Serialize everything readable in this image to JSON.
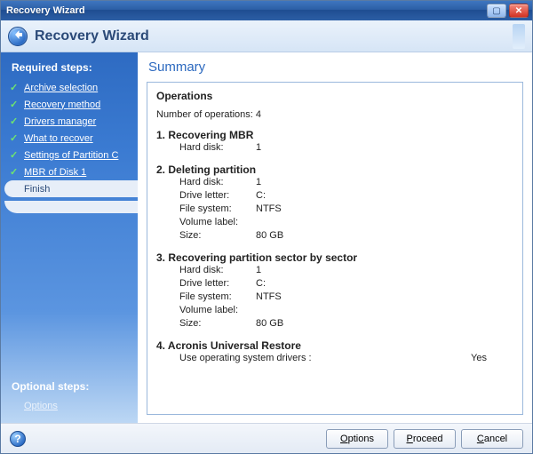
{
  "window": {
    "title": "Recovery Wizard",
    "maximize_icon": "maximize-icon",
    "close_icon": "close-icon"
  },
  "header": {
    "title": "Recovery Wizard",
    "back_icon": "back-arrow-icon"
  },
  "sidebar": {
    "required_heading": "Required steps:",
    "steps": [
      {
        "label": "Archive selection",
        "done": true
      },
      {
        "label": "Recovery method",
        "done": true
      },
      {
        "label": "Drivers manager",
        "done": true
      },
      {
        "label": "What to recover",
        "done": true
      },
      {
        "label": "Settings of Partition C",
        "done": true
      },
      {
        "label": "MBR of Disk 1",
        "done": true
      },
      {
        "label": "Finish",
        "current": true
      }
    ],
    "optional_heading": "Optional steps:",
    "options_label": "Options"
  },
  "content": {
    "title": "Summary",
    "ops_title": "Operations",
    "count_label": "Number of operations:",
    "count_value": "4",
    "operations": [
      {
        "num": "1.",
        "name": "Recovering MBR",
        "fields": [
          {
            "k": "Hard disk:",
            "v": "1"
          }
        ]
      },
      {
        "num": "2.",
        "name": "Deleting partition",
        "fields": [
          {
            "k": "Hard disk:",
            "v": "1"
          },
          {
            "k": "Drive letter:",
            "v": "C:"
          },
          {
            "k": "File system:",
            "v": "NTFS"
          },
          {
            "k": "Volume label:",
            "v": ""
          },
          {
            "k": "Size:",
            "v": "80 GB"
          }
        ]
      },
      {
        "num": "3.",
        "name": "Recovering partition sector by sector",
        "fields": [
          {
            "k": "Hard disk:",
            "v": "1"
          },
          {
            "k": "Drive letter:",
            "v": "C:"
          },
          {
            "k": "File system:",
            "v": "NTFS"
          },
          {
            "k": "Volume label:",
            "v": ""
          },
          {
            "k": "Size:",
            "v": "80 GB"
          }
        ]
      },
      {
        "num": "4.",
        "name": "Acronis Universal Restore",
        "wide_field": {
          "k": "Use operating system drivers :",
          "v": "Yes"
        }
      }
    ]
  },
  "footer": {
    "help_icon": "help-icon",
    "options_btn": "Options",
    "options_accel": "O",
    "proceed_btn": "Proceed",
    "proceed_accel": "P",
    "cancel_btn": "Cancel",
    "cancel_accel": "C"
  }
}
